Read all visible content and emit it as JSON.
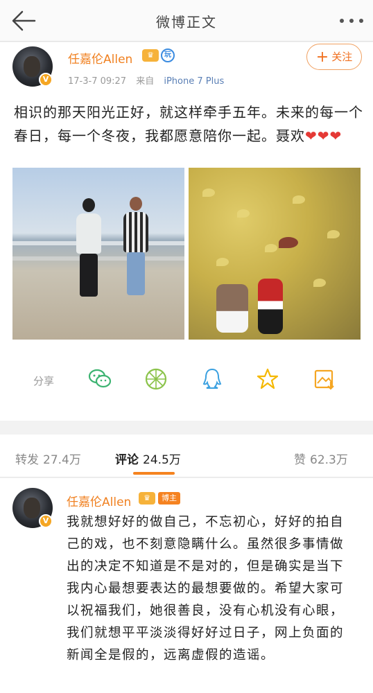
{
  "topbar": {
    "title": "微博正文"
  },
  "post": {
    "username": "任嘉伦Allen",
    "verified_badge": "V",
    "play_badge": "玩",
    "time": "17-3-7 09:27",
    "source_label": "来自",
    "device": "iPhone 7 Plus",
    "follow_label": "关注",
    "text": "相识的那天阳光正好，就这样牵手五年。未来的每一个春日，每一个冬夜，我都愿意陪你一起。聂欢",
    "hearts": "❤❤❤"
  },
  "actions": {
    "share_label": "分享",
    "icons": [
      "wechat-icon",
      "moments-icon",
      "qq-icon",
      "qzone-star-icon",
      "save-image-icon"
    ]
  },
  "tabs": [
    {
      "label": "转发",
      "count": "27.4万"
    },
    {
      "label": "评论",
      "count": "24.5万"
    },
    {
      "label": "赞",
      "count": "62.3万"
    }
  ],
  "comment": {
    "username": "任嘉伦Allen",
    "verified_badge": "V",
    "host_badge": "博主",
    "text": "我就想好好的做自己，不忘初心，好好的拍自己的戏，也不刻意隐瞒什么。虽然很多事情做出的决定不知道是不是对的，但是确实是当下我内心最想要表达的最想要做的。希望大家可以祝福我们，她很善良，没有心机没有心眼，我们就想平平淡淡得好好过日子，网上负面的新闻全是假的，远离虚假的造谣。"
  },
  "colors": {
    "accent": "#f5831f",
    "name": "#f08020",
    "link": "#5a7fb5"
  }
}
